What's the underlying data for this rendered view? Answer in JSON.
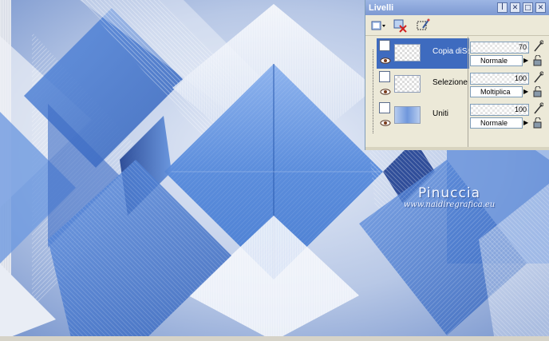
{
  "canvas": {
    "watermark": {
      "name": "Pinuccia",
      "site": "www.naidiregrafica.eu"
    }
  },
  "palette": {
    "title": "Livelli",
    "title_buttons": [
      "ꟾ",
      "✕",
      "□",
      "✕"
    ],
    "layers": [
      {
        "name": "Copia diSelezione",
        "opacity": "70",
        "blend_mode": "Normale",
        "selected": true
      },
      {
        "name": "Selezione innalzata",
        "opacity": "100",
        "blend_mode": "Moltiplica",
        "selected": false
      },
      {
        "name": "Uniti",
        "opacity": "100",
        "blend_mode": "Normale",
        "selected": false
      }
    ]
  },
  "colors": {
    "accent": "#3e6bbf",
    "title_bar": "#7d99d2",
    "panel_bg": "#ece9d8",
    "canvas_blue": "#4f82d6"
  }
}
